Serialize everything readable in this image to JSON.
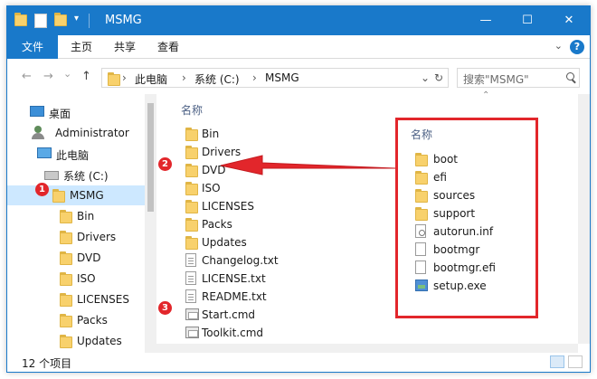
{
  "window": {
    "title": "MSMG",
    "minimize": "—",
    "maximize": "☐",
    "close": "✕"
  },
  "ribbon": {
    "tabs": [
      "文件",
      "主页",
      "共享",
      "查看"
    ],
    "help": "?"
  },
  "address": {
    "back": "←",
    "forward": "→",
    "recent": "⌄",
    "up": "↑",
    "crumbs": [
      "此电脑",
      "系统 (C:)",
      "MSMG"
    ],
    "separator": "›",
    "refresh": "↻",
    "dropdown": "⌄",
    "search_placeholder": "搜索\"MSMG\""
  },
  "nav_pane": {
    "items": [
      {
        "label": "桌面",
        "icon": "desktop-icon"
      },
      {
        "label": "Administrator",
        "icon": "user-icon"
      },
      {
        "label": "此电脑",
        "icon": "computer-icon"
      },
      {
        "label": "系统 (C:)",
        "icon": "drive-icon"
      },
      {
        "label": "MSMG",
        "icon": "folder-icon",
        "selected": true
      },
      {
        "label": "Bin",
        "icon": "folder-icon"
      },
      {
        "label": "Drivers",
        "icon": "folder-icon"
      },
      {
        "label": "DVD",
        "icon": "folder-icon"
      },
      {
        "label": "ISO",
        "icon": "folder-icon"
      },
      {
        "label": "LICENSES",
        "icon": "folder-icon"
      },
      {
        "label": "Packs",
        "icon": "folder-icon"
      },
      {
        "label": "Updates",
        "icon": "folder-icon"
      }
    ]
  },
  "main_pane": {
    "column_header": "名称",
    "files": [
      {
        "name": "Bin",
        "icon": "folder-icon"
      },
      {
        "name": "Drivers",
        "icon": "folder-icon"
      },
      {
        "name": "DVD",
        "icon": "folder-icon"
      },
      {
        "name": "ISO",
        "icon": "folder-icon"
      },
      {
        "name": "LICENSES",
        "icon": "folder-icon"
      },
      {
        "name": "Packs",
        "icon": "folder-icon"
      },
      {
        "name": "Updates",
        "icon": "folder-icon"
      },
      {
        "name": "Changelog.txt",
        "icon": "text-file-icon"
      },
      {
        "name": "LICENSE.txt",
        "icon": "text-file-icon"
      },
      {
        "name": "README.txt",
        "icon": "text-file-icon"
      },
      {
        "name": "Start.cmd",
        "icon": "cmd-file-icon"
      },
      {
        "name": "Toolkit.cmd",
        "icon": "cmd-file-icon"
      }
    ]
  },
  "status_bar": {
    "item_count": "12 个项目"
  },
  "annotation": {
    "header": "名称",
    "files": [
      {
        "name": "boot",
        "icon": "folder-icon"
      },
      {
        "name": "efi",
        "icon": "folder-icon"
      },
      {
        "name": "sources",
        "icon": "folder-icon"
      },
      {
        "name": "support",
        "icon": "folder-icon"
      },
      {
        "name": "autorun.inf",
        "icon": "inf-file-icon"
      },
      {
        "name": "bootmgr",
        "icon": "file-icon"
      },
      {
        "name": "bootmgr.efi",
        "icon": "file-icon"
      },
      {
        "name": "setup.exe",
        "icon": "exe-file-icon"
      }
    ],
    "badges": [
      "1",
      "2",
      "3"
    ],
    "color": "#e2262b"
  },
  "colors": {
    "accent": "#1979ca",
    "selection": "#cde8ff",
    "folder": "#f8d16c"
  }
}
